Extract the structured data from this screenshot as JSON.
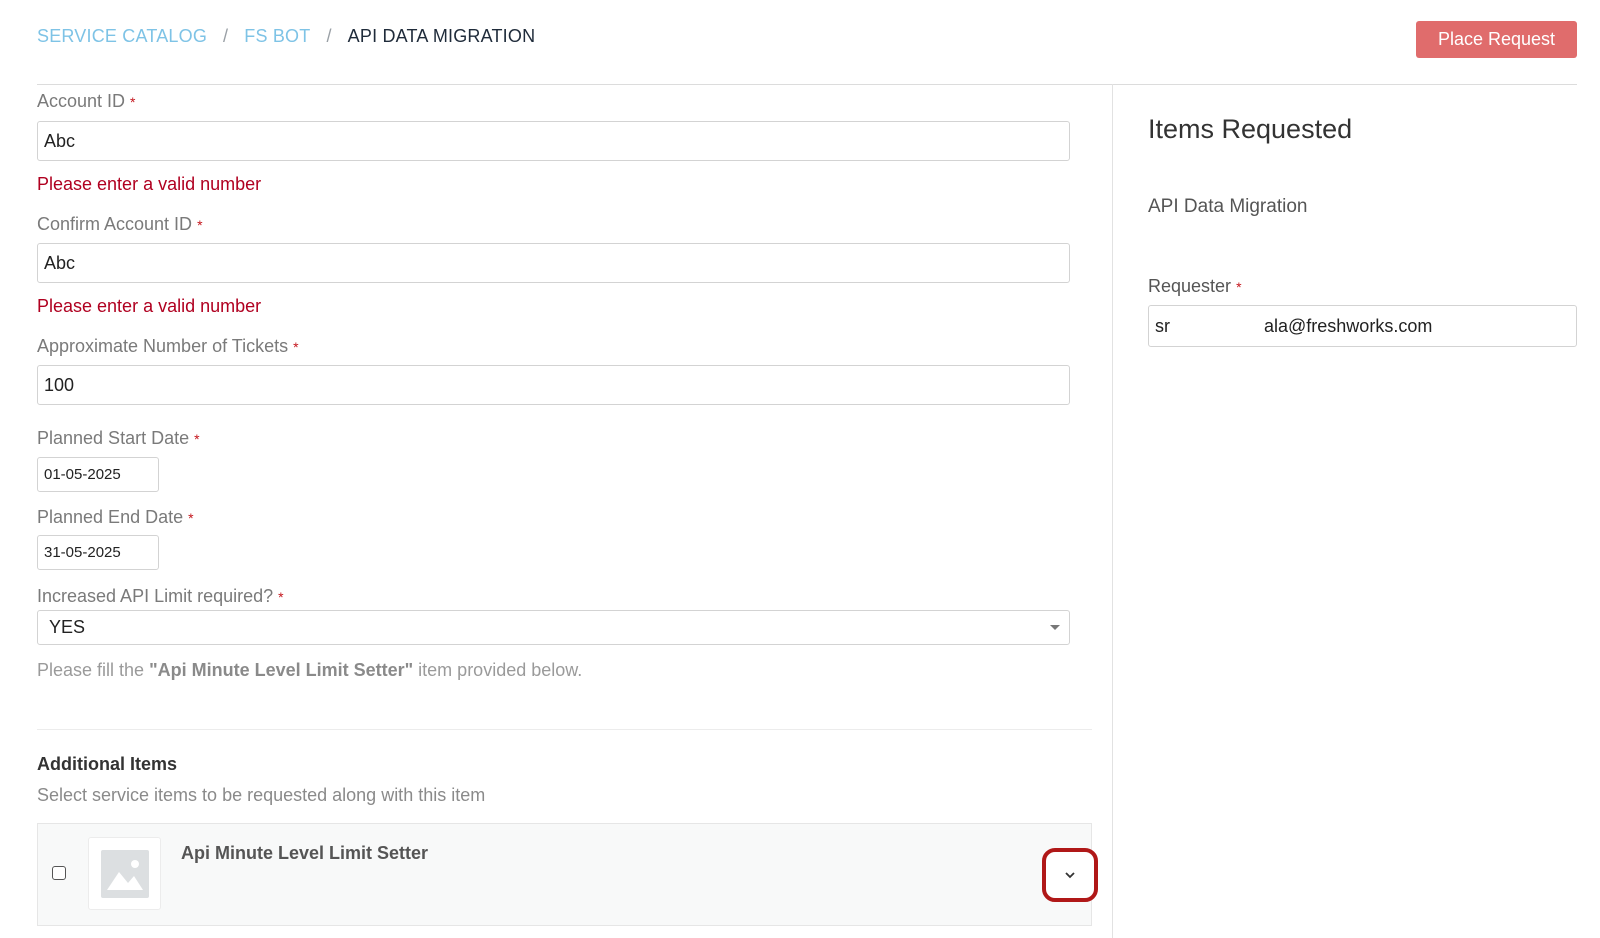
{
  "breadcrumb": {
    "items": [
      "SERVICE CATALOG",
      "FS BOT"
    ],
    "current": "API DATA MIGRATION",
    "separator": "/"
  },
  "header": {
    "place_request_label": "Place Request"
  },
  "form": {
    "account_id": {
      "label": "Account ID",
      "value": "Abc",
      "error": "Please enter a valid number"
    },
    "confirm_account_id": {
      "label": "Confirm Account ID",
      "value": "Abc",
      "error": "Please enter a valid number"
    },
    "approx_tickets": {
      "label": "Approximate Number of Tickets",
      "value": "100"
    },
    "planned_start": {
      "label": "Planned Start Date",
      "value": "01-05-2025"
    },
    "planned_end": {
      "label": "Planned End Date",
      "value": "31-05-2025"
    },
    "increased_api": {
      "label": "Increased API Limit required?",
      "selected": "YES"
    },
    "hint": {
      "prefix": "Please fill the ",
      "bold": "\"Api Minute Level Limit Setter\"",
      "suffix": " item provided below."
    },
    "required_mark": "*"
  },
  "additional_items": {
    "title": "Additional Items",
    "subtitle": "Select service items to be requested along with this item",
    "items": [
      {
        "name": "Api Minute Level Limit Setter",
        "checked": false
      }
    ]
  },
  "sidebar": {
    "title": "Items Requested",
    "item": "API Data Migration",
    "requester_label": "Requester",
    "requester_value_prefix": "sr",
    "requester_value_suffix": "ala@freshworks.com"
  },
  "colors": {
    "accent_link": "#7ec3e6",
    "place_request_bg": "#e06c6c",
    "error": "#b00020",
    "required": "#c4151c",
    "highlight_border": "#b01818"
  },
  "icons": [
    "image-placeholder-icon",
    "chevron-down-icon",
    "dropdown-caret-icon"
  ]
}
